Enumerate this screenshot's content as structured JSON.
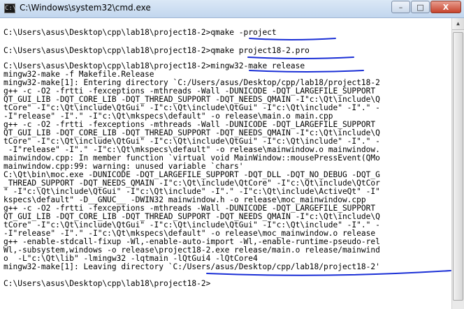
{
  "window": {
    "title": "C:\\Windows\\system32\\cmd.exe",
    "icon": "C:\\",
    "controls": {
      "minimize": "–",
      "maximize": "□",
      "close": "X"
    }
  },
  "console": {
    "lines": [
      "",
      "C:\\Users\\asus\\Desktop\\cpp\\lab18\\project18-2>qmake -project",
      "",
      "C:\\Users\\asus\\Desktop\\cpp\\lab18\\project18-2>qmake project18-2.pro",
      "",
      "C:\\Users\\asus\\Desktop\\cpp\\lab18\\project18-2>mingw32-make release",
      "mingw32-make -f Makefile.Release",
      "mingw32-make[1]: Entering directory `C:/Users/asus/Desktop/cpp/lab18/project18-2",
      "g++ -c -O2 -frtti -fexceptions -mthreads -Wall -DUNICODE -DQT_LARGEFILE_SUPPORT",
      "QT_GUI_LIB -DQT_CORE_LIB -DQT_THREAD_SUPPORT -DQT_NEEDS_QMAIN -I\"c:\\Qt\\include\\Q",
      "tCore\" -I\"c:\\Qt\\include\\QtGui\" -I\"c:\\Qt\\include\\QtGui\" -I\"c:\\Qt\\include\" -I\".\" -",
      "-I\"release\" -I\".\" -I\"c:\\Qt\\mkspecs\\default\" -o release\\main.o main.cpp",
      "g++ -c -O2 -frtti -fexceptions -mthreads -Wall -DUNICODE -DQT_LARGEFILE_SUPPORT",
      "QT_GUI_LIB -DQT_CORE_LIB -DQT_THREAD_SUPPORT -DQT_NEEDS_QMAIN -I\"c:\\Qt\\include\\Q",
      "tCore\" -I\"c:\\Qt\\include\\QtGui\" -I\"c:\\Qt\\include\\QtGui\" -I\"c:\\Qt\\include\" -I\".\" -",
      " -I\"release\" -I\".\" -I\"c:\\Qt\\mkspecs\\default\" -o release\\mainwindow.o mainwindow.",
      "mainwindow.cpp: In member function `virtual void MainWindow::mousePressEvent(QMo",
      "mainwindow.cpp:99: warning: unused variable `chars'",
      "C:\\Qt\\bin\\moc.exe -DUNICODE -DQT_LARGEFILE_SUPPORT -DQT_DLL -DQT_NO_DEBUG -DQT_G",
      "_THREAD_SUPPORT -DQT_NEEDS_QMAIN -I\"c:\\Qt\\include\\QtCore\" -I\"c:\\Qt\\include\\QtCor",
      "\" -I\"c:\\Qt\\include\\QtGui\" -I\"c:\\Qt\\include\" -I\".\" -I\"c:\\Qt\\include\\ActiveQt\" -I\"",
      "kspecs\\default\" -D__GNUC__ -DWIN32 mainwindow.h -o release\\moc_mainwindow.cpp",
      "g++ -c -O2 -frtti -fexceptions -mthreads -Wall -DUNICODE -DQT_LARGEFILE_SUPPORT",
      "QT_GUI_LIB -DQT_CORE_LIB -DQT_THREAD_SUPPORT -DQT_NEEDS_QMAIN -I\"c:\\Qt\\include\\Q",
      "tCore\" -I\"c:\\Qt\\include\\QtGui\" -I\"c:\\Qt\\include\\QtGui\" -I\"c:\\Qt\\include\" -I\".\" -",
      "-I\"release\" -I\".\" -I\"c:\\Qt\\mkspecs\\default\" -o release\\moc_mainwindow.o release",
      "g++ -enable-stdcall-fixup -Wl,-enable-auto-import -Wl,-enable-runtime-pseudo-rel",
      "Wl,-subsystem,windows -o release\\project18-2.exe release/main.o release/mainwind",
      "o  -L\"c:\\Qt\\lib\" -lmingw32 -lqtmain -lQtGui4 -lQtCore4",
      "mingw32-make[1]: Leaving directory `C:/Users/asus/Desktop/cpp/lab18/project18-2'",
      "",
      "C:\\Users\\asus\\Desktop\\cpp\\lab18\\project18-2>"
    ]
  },
  "annotation_color": "#1a2fd6"
}
